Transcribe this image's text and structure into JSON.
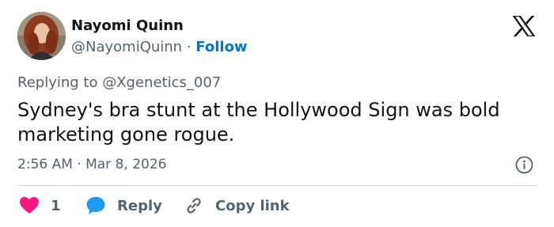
{
  "author": {
    "name": "Nayomi Quinn",
    "handle": "@NayomiQuinn",
    "separator": "·",
    "follow_label": "Follow"
  },
  "reply_context": {
    "prefix": "Replying to",
    "mention": "@Xgenetics_007"
  },
  "tweet_text": "Sydney's bra stunt at the Hollywood Sign was bold marketing gone rogue.",
  "timestamp": "2:56 AM · Mar 8, 2026",
  "actions": {
    "like_count": "1",
    "reply_label": "Reply",
    "copy_label": "Copy link"
  },
  "icons": {
    "logo": "x-logo-icon",
    "info": "info-icon",
    "like": "heart-icon",
    "reply": "speech-bubble-icon",
    "copy": "link-icon"
  },
  "colors": {
    "follow": "#0074d4",
    "heart": "#f91880",
    "reply_bubble": "#1d9bf0",
    "secondary_text": "#536471"
  }
}
